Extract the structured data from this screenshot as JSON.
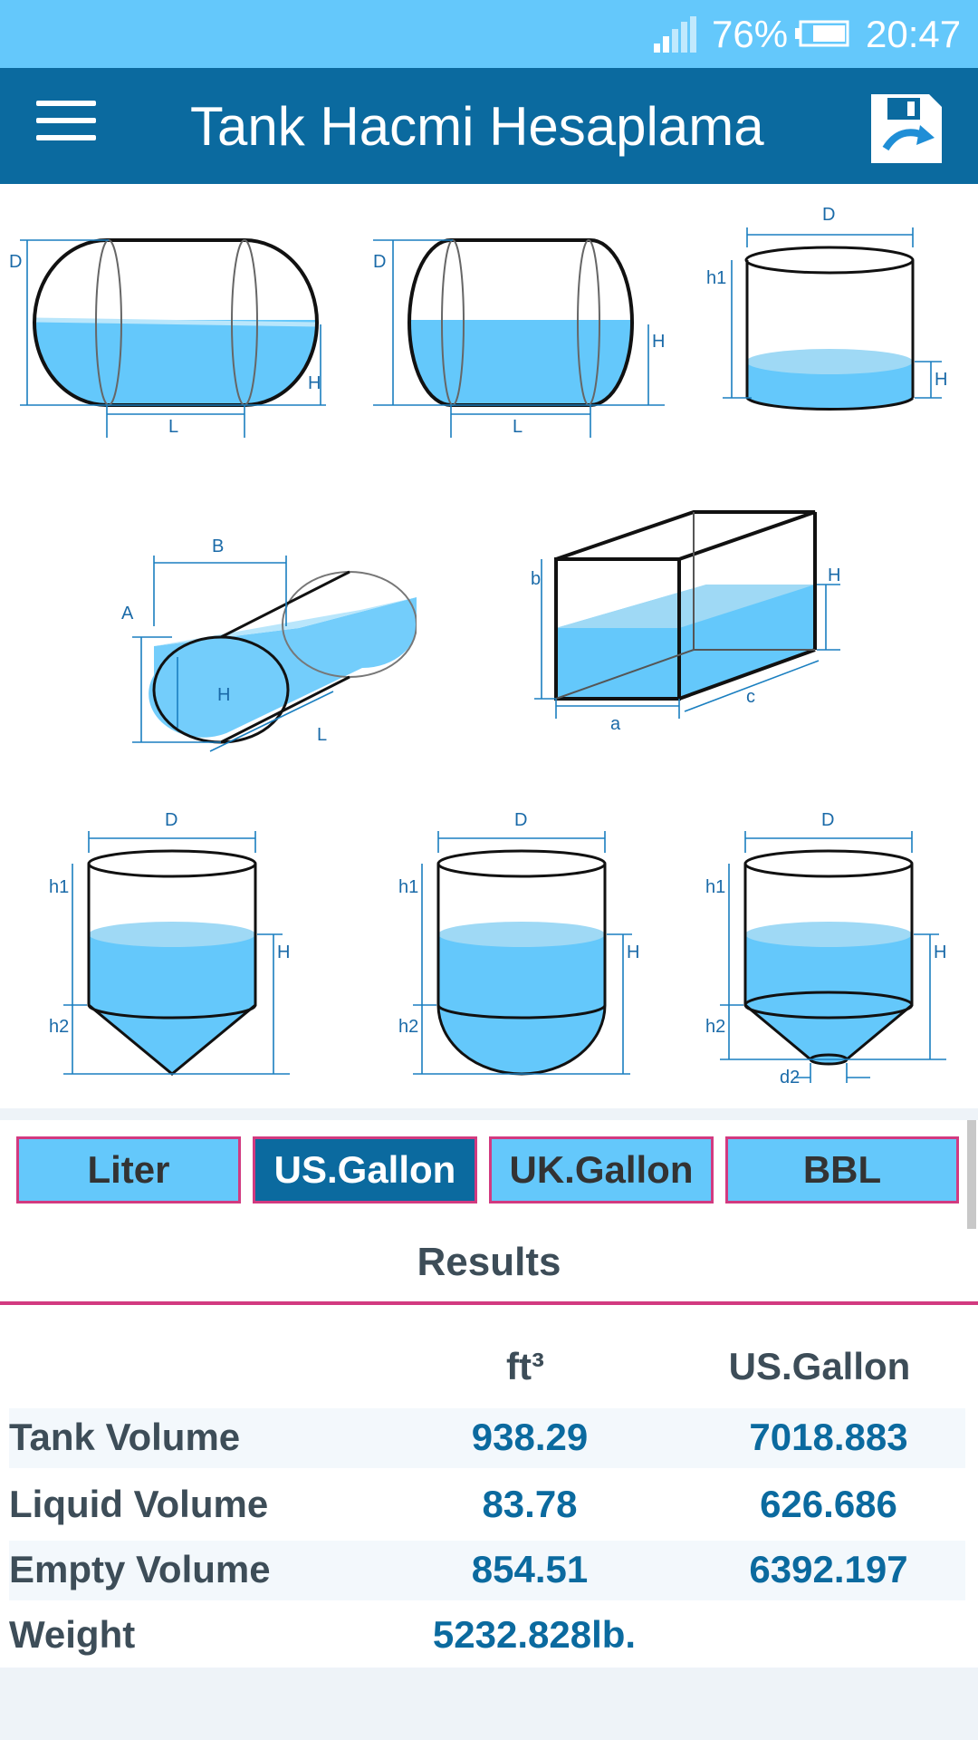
{
  "status_bar": {
    "battery": "76%",
    "time": "20:47"
  },
  "app_bar": {
    "title": "Tank Hacmi Hesaplama"
  },
  "diagram_labels": {
    "D": "D",
    "L": "L",
    "H": "H",
    "h1": "h1",
    "h2": "h2",
    "A": "A",
    "B": "B",
    "a": "a",
    "b": "b",
    "c": "c",
    "d2": "d2"
  },
  "units": {
    "selected": "US.Gallon",
    "options": [
      "Liter",
      "US.Gallon",
      "UK.Gallon",
      "BBL"
    ]
  },
  "results": {
    "title": "Results",
    "columns": [
      "ft³",
      "US.Gallon"
    ],
    "rows": [
      {
        "label": "Tank Volume",
        "ft3": "938.29",
        "gal": "7018.883"
      },
      {
        "label": "Liquid Volume",
        "ft3": "83.78",
        "gal": "626.686"
      },
      {
        "label": "Empty Volume",
        "ft3": "854.51",
        "gal": "6392.197"
      }
    ],
    "weight": {
      "label": "Weight",
      "value": "5232.828lb."
    }
  },
  "colors": {
    "status": "#64c8fb",
    "appbar": "#0b6a9f",
    "accent": "#d23a80",
    "liquid": "#64c8fb"
  }
}
